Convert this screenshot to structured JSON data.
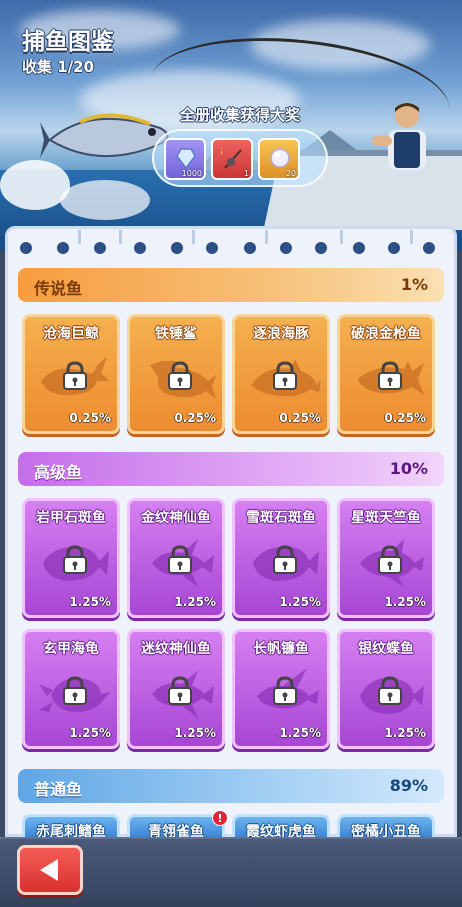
{
  "header": {
    "title": "捕鱼图鉴",
    "collection_label": "收集 1/20"
  },
  "reward": {
    "title": "全册收集获得大奖",
    "items": [
      {
        "icon": "crystal-icon",
        "amount": "1000",
        "color": "#8a7be6"
      },
      {
        "icon": "fishing-rod-s-icon",
        "amount": "1",
        "color": "#e04848"
      },
      {
        "icon": "pearl-icon",
        "amount": "20",
        "color": "#e9a83a"
      }
    ]
  },
  "sections": {
    "legend": {
      "name": "传说鱼",
      "percent": "1%",
      "fish": [
        {
          "name": "沧海巨鲸",
          "rate": "0.25%",
          "icon": "whale-icon"
        },
        {
          "name": "铁锤鲨",
          "rate": "0.25%",
          "icon": "hammerhead-shark-icon"
        },
        {
          "name": "逐浪海豚",
          "rate": "0.25%",
          "icon": "dolphin-icon"
        },
        {
          "name": "破浪金枪鱼",
          "rate": "0.25%",
          "icon": "tuna-icon"
        }
      ]
    },
    "advanced": {
      "name": "高级鱼",
      "percent": "10%",
      "fish": [
        {
          "name": "岩甲石斑鱼",
          "rate": "1.25%",
          "icon": "grouper-icon"
        },
        {
          "name": "金纹神仙鱼",
          "rate": "1.25%",
          "icon": "angelfish-icon"
        },
        {
          "name": "雪斑石斑鱼",
          "rate": "1.25%",
          "icon": "grouper-icon"
        },
        {
          "name": "星斑天竺鱼",
          "rate": "1.25%",
          "icon": "cardinalfish-icon"
        },
        {
          "name": "玄甲海龟",
          "rate": "1.25%",
          "icon": "turtle-icon"
        },
        {
          "name": "迷纹神仙鱼",
          "rate": "1.25%",
          "icon": "angelfish-icon"
        },
        {
          "name": "长帆镰鱼",
          "rate": "1.25%",
          "icon": "moorish-idol-icon"
        },
        {
          "name": "银纹蝶鱼",
          "rate": "1.25%",
          "icon": "butterflyfish-icon"
        }
      ]
    },
    "common": {
      "name": "普通鱼",
      "percent": "89%",
      "fish": [
        {
          "name": "赤尾刺鳍鱼",
          "alert": false
        },
        {
          "name": "青翎雀鱼",
          "alert": true,
          "alert_text": "!"
        },
        {
          "name": "霞纹虾虎鱼",
          "alert": false
        },
        {
          "name": "密橘小丑鱼",
          "alert": false
        }
      ]
    }
  },
  "colors": {
    "legend_bar": "#f7a64a",
    "advanced_bar": "#d58ef0",
    "common_bar": "#7cbcef"
  }
}
